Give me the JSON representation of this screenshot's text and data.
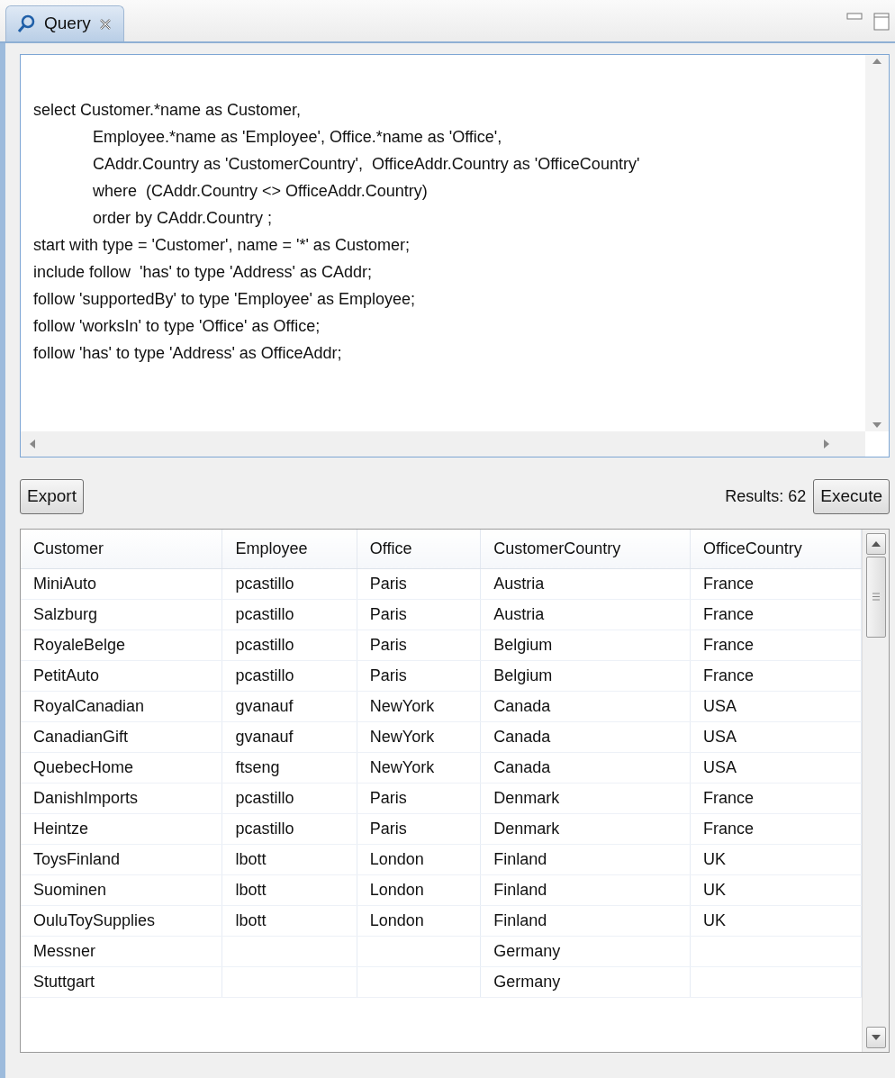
{
  "tab": {
    "label": "Query",
    "selected": true
  },
  "query_lines": [
    {
      "text": "select Customer.*name as Customer,",
      "indented": false
    },
    {
      "text": "Employee.*name as 'Employee', Office.*name as 'Office',",
      "indented": true
    },
    {
      "text": "CAddr.Country as 'CustomerCountry',  OfficeAddr.Country as 'OfficeCountry'",
      "indented": true
    },
    {
      "text": "where  (CAddr.Country <> OfficeAddr.Country)",
      "indented": true
    },
    {
      "text": "order by CAddr.Country ;",
      "indented": true
    },
    {
      "text": "start with type = 'Customer', name = '*' as Customer;",
      "indented": false
    },
    {
      "text": "include follow  'has' to type 'Address' as CAddr;",
      "indented": false
    },
    {
      "text": "follow 'supportedBy' to type 'Employee' as Employee;",
      "indented": false
    },
    {
      "text": "follow 'worksIn' to type 'Office' as Office;",
      "indented": false
    },
    {
      "text": "follow 'has' to type 'Address' as OfficeAddr;",
      "indented": false
    }
  ],
  "buttons": {
    "export": "Export",
    "results": "Results: 62",
    "execute": "Execute"
  },
  "table": {
    "columns": [
      "Customer",
      "Employee",
      "Office",
      "CustomerCountry",
      "OfficeCountry"
    ],
    "rows": [
      [
        "MiniAuto",
        "pcastillo",
        "Paris",
        "Austria",
        "France"
      ],
      [
        "Salzburg",
        "pcastillo",
        "Paris",
        "Austria",
        "France"
      ],
      [
        "RoyaleBelge",
        "pcastillo",
        "Paris",
        "Belgium",
        "France"
      ],
      [
        "PetitAuto",
        "pcastillo",
        "Paris",
        "Belgium",
        "France"
      ],
      [
        "RoyalCanadian",
        "gvanauf",
        "NewYork",
        "Canada",
        "USA"
      ],
      [
        "CanadianGift",
        "gvanauf",
        "NewYork",
        "Canada",
        "USA"
      ],
      [
        "QuebecHome",
        "ftseng",
        "NewYork",
        "Canada",
        "USA"
      ],
      [
        "DanishImports",
        "pcastillo",
        "Paris",
        "Denmark",
        "France"
      ],
      [
        "Heintze",
        "pcastillo",
        "Paris",
        "Denmark",
        "France"
      ],
      [
        "ToysFinland",
        "lbott",
        "London",
        "Finland",
        "UK"
      ],
      [
        "Suominen",
        "lbott",
        "London",
        "Finland",
        "UK"
      ],
      [
        "OuluToySupplies",
        "lbott",
        "London",
        "Finland",
        "UK"
      ],
      [
        "Messner",
        null,
        null,
        "Germany",
        null
      ],
      [
        "Stuttgart",
        null,
        null,
        "Germany",
        null
      ]
    ]
  }
}
